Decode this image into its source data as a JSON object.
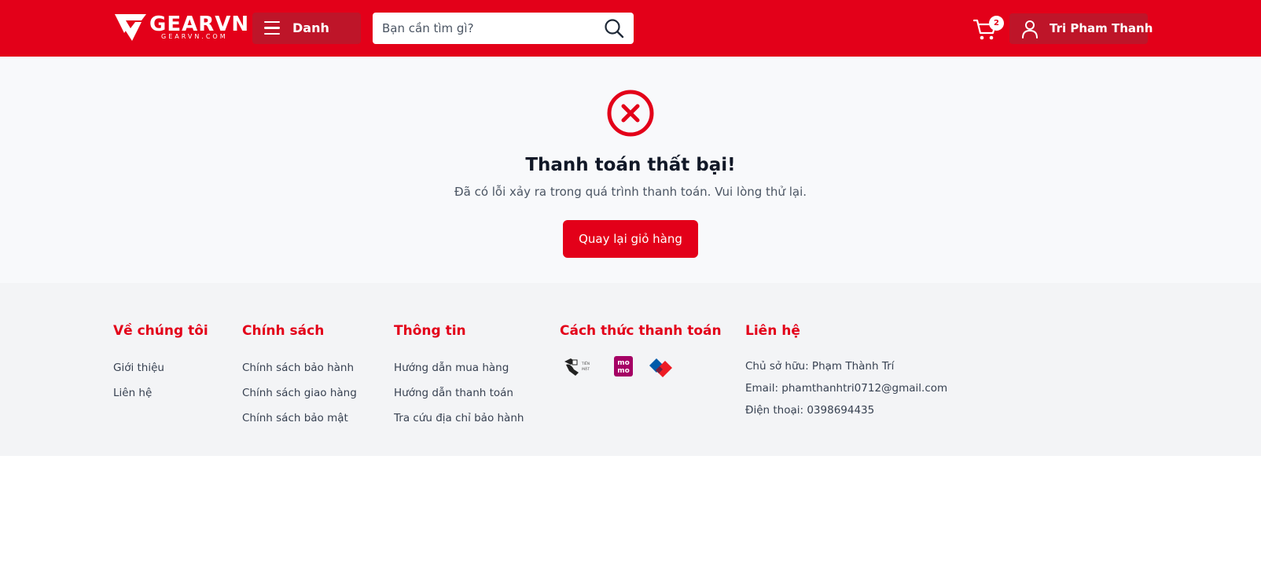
{
  "header": {
    "logo_text": "GEARVN",
    "logo_sub": "GEARVN.COM",
    "menu_label": "Danh mục",
    "search_placeholder": "Bạn cần tìm gì?",
    "cart_count": "2",
    "user_name": "Tri Pham Thanh",
    "brand_color": "#e30019"
  },
  "result": {
    "title": "Thanh toán thất bại!",
    "message": "Đã có lỗi xảy ra trong quá trình thanh toán. Vui lòng thử lại.",
    "button_label": "Quay lại giỏ hàng"
  },
  "footer": {
    "about": {
      "title": "Về chúng tôi",
      "items": [
        "Giới thiệu",
        "Liên hệ"
      ]
    },
    "policy": {
      "title": "Chính sách",
      "items": [
        "Chính sách bảo hành",
        "Chính sách giao hàng",
        "Chính sách bảo mật"
      ]
    },
    "info": {
      "title": "Thông tin",
      "items": [
        "Hướng dẫn mua hàng",
        "Hướng dẫn thanh toán",
        "Tra cứu địa chỉ bảo hành"
      ]
    },
    "payment": {
      "title": "Cách thức thanh toán",
      "methods": [
        {
          "name": "cash-icon",
          "text": "TIỀN MẶT"
        },
        {
          "name": "momo-icon",
          "text": "mo mo"
        },
        {
          "name": "vnpay-icon",
          "text": ""
        }
      ]
    },
    "contact": {
      "title": "Liên hệ",
      "items": [
        "Chủ sở hữu: Phạm Thành Trí",
        "Email: phamthanhtri0712@gmail.com",
        "Điện thoại: 0398694435"
      ]
    }
  }
}
